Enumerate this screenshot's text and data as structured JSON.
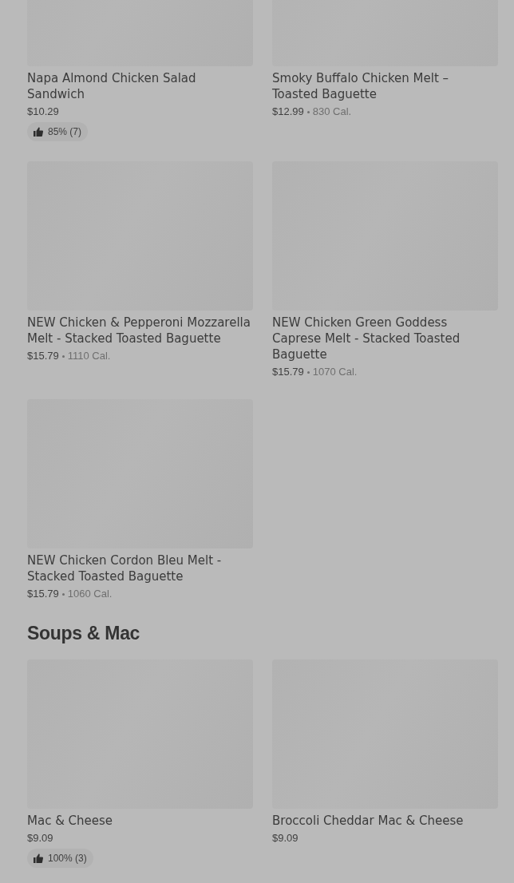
{
  "sections": [
    {
      "items": [
        {
          "name": "Napa Almond Chicken Salad Sandwich",
          "price": "$10.29",
          "rating": "85% (7)"
        },
        {
          "name": "Smoky Buffalo Chicken Melt – Toasted Baguette",
          "price": "$12.99",
          "calories": "830 Cal."
        },
        {
          "name": "NEW Chicken & Pepperoni Mozzarella Melt - Stacked Toasted Baguette",
          "price": "$15.79",
          "calories": "1110 Cal."
        },
        {
          "name": "NEW Chicken Green Goddess Caprese Melt - Stacked Toasted Baguette",
          "price": "$15.79",
          "calories": "1070 Cal."
        },
        {
          "name": "NEW Chicken Cordon Bleu Melt - Stacked Toasted Baguette",
          "price": "$15.79",
          "calories": "1060 Cal."
        }
      ]
    },
    {
      "title": "Soups & Mac",
      "items": [
        {
          "name": "Mac & Cheese",
          "price": "$9.09",
          "rating": "100% (3)"
        },
        {
          "name": "Broccoli Cheddar Mac & Cheese",
          "price": "$9.09"
        }
      ]
    }
  ]
}
